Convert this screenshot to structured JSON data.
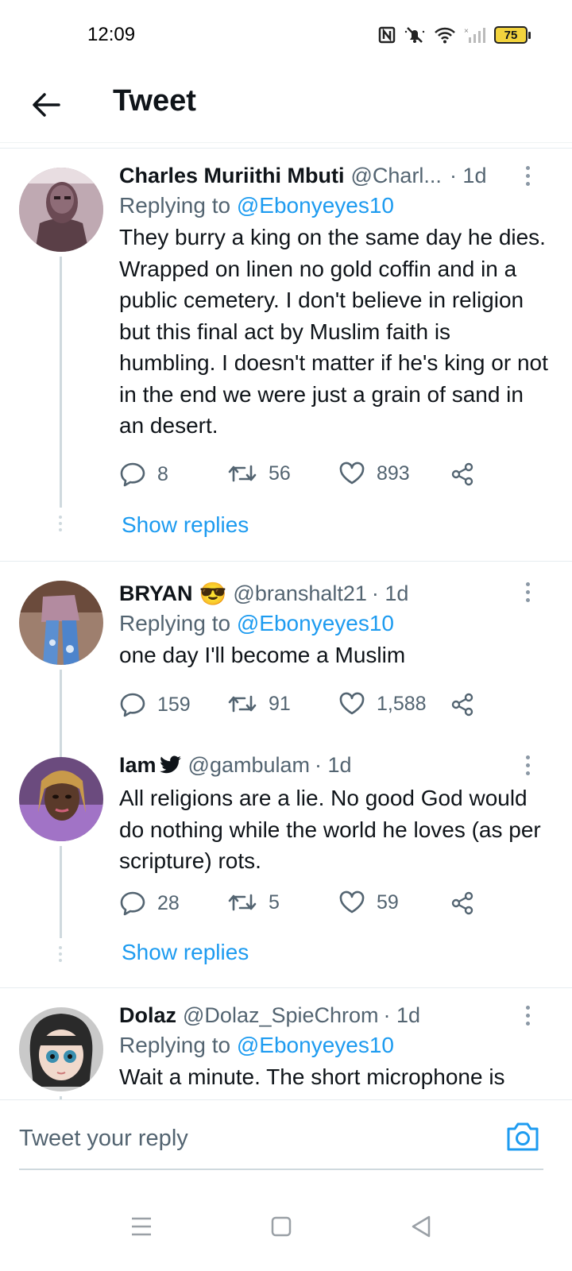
{
  "status_bar": {
    "time": "12:09",
    "battery": "75"
  },
  "header": {
    "title": "Tweet"
  },
  "tweets": [
    {
      "name": "Charles Muriithi Mbuti",
      "handle": "@Charl...",
      "time": "· 1d",
      "replying_prefix": "Replying to",
      "replying_to": "@Ebonyeyes10",
      "body": "They burry a king on the same day he dies. Wrapped on linen no gold coffin and in a public cemetery. I don't believe in religion but this final act by Muslim faith is humbling. I doesn't matter if he's king or not in the end we were just a grain of sand in an desert.",
      "replies": "8",
      "retweets": "56",
      "likes": "893",
      "show_replies": "Show replies"
    },
    {
      "name": "BRYAN",
      "emoji": "😎",
      "handle": "@branshalt21",
      "time": "· 1d",
      "replying_prefix": "Replying to",
      "replying_to": "@Ebonyeyes10",
      "body": "one day I'll become a Muslim",
      "replies": "159",
      "retweets": "91",
      "likes": "1,588"
    },
    {
      "name": "Iam",
      "handle": "@gambulam",
      "time": "· 1d",
      "body": "All religions are a lie. No good God would do nothing while the world he loves (as per scripture) rots.",
      "replies": "28",
      "retweets": "5",
      "likes": "59",
      "show_replies": "Show replies"
    },
    {
      "name": "Dolaz",
      "handle": "@Dolaz_SpieChrom",
      "time": "· 1d",
      "replying_prefix": "Replying to",
      "replying_to": "@Ebonyeyes10",
      "body": "Wait a minute. The short microphone is"
    }
  ],
  "reply_bar": {
    "placeholder": "Tweet your reply"
  },
  "colors": {
    "accent": "#1d9bf0",
    "secondary_text": "#536471",
    "divider": "#e6ecf0"
  },
  "icons": [
    "back-arrow-icon",
    "reply-icon",
    "retweet-icon",
    "like-icon",
    "share-icon",
    "more-icon",
    "camera-icon",
    "bird-icon",
    "menu-icon",
    "home-icon",
    "back-nav-icon"
  ]
}
